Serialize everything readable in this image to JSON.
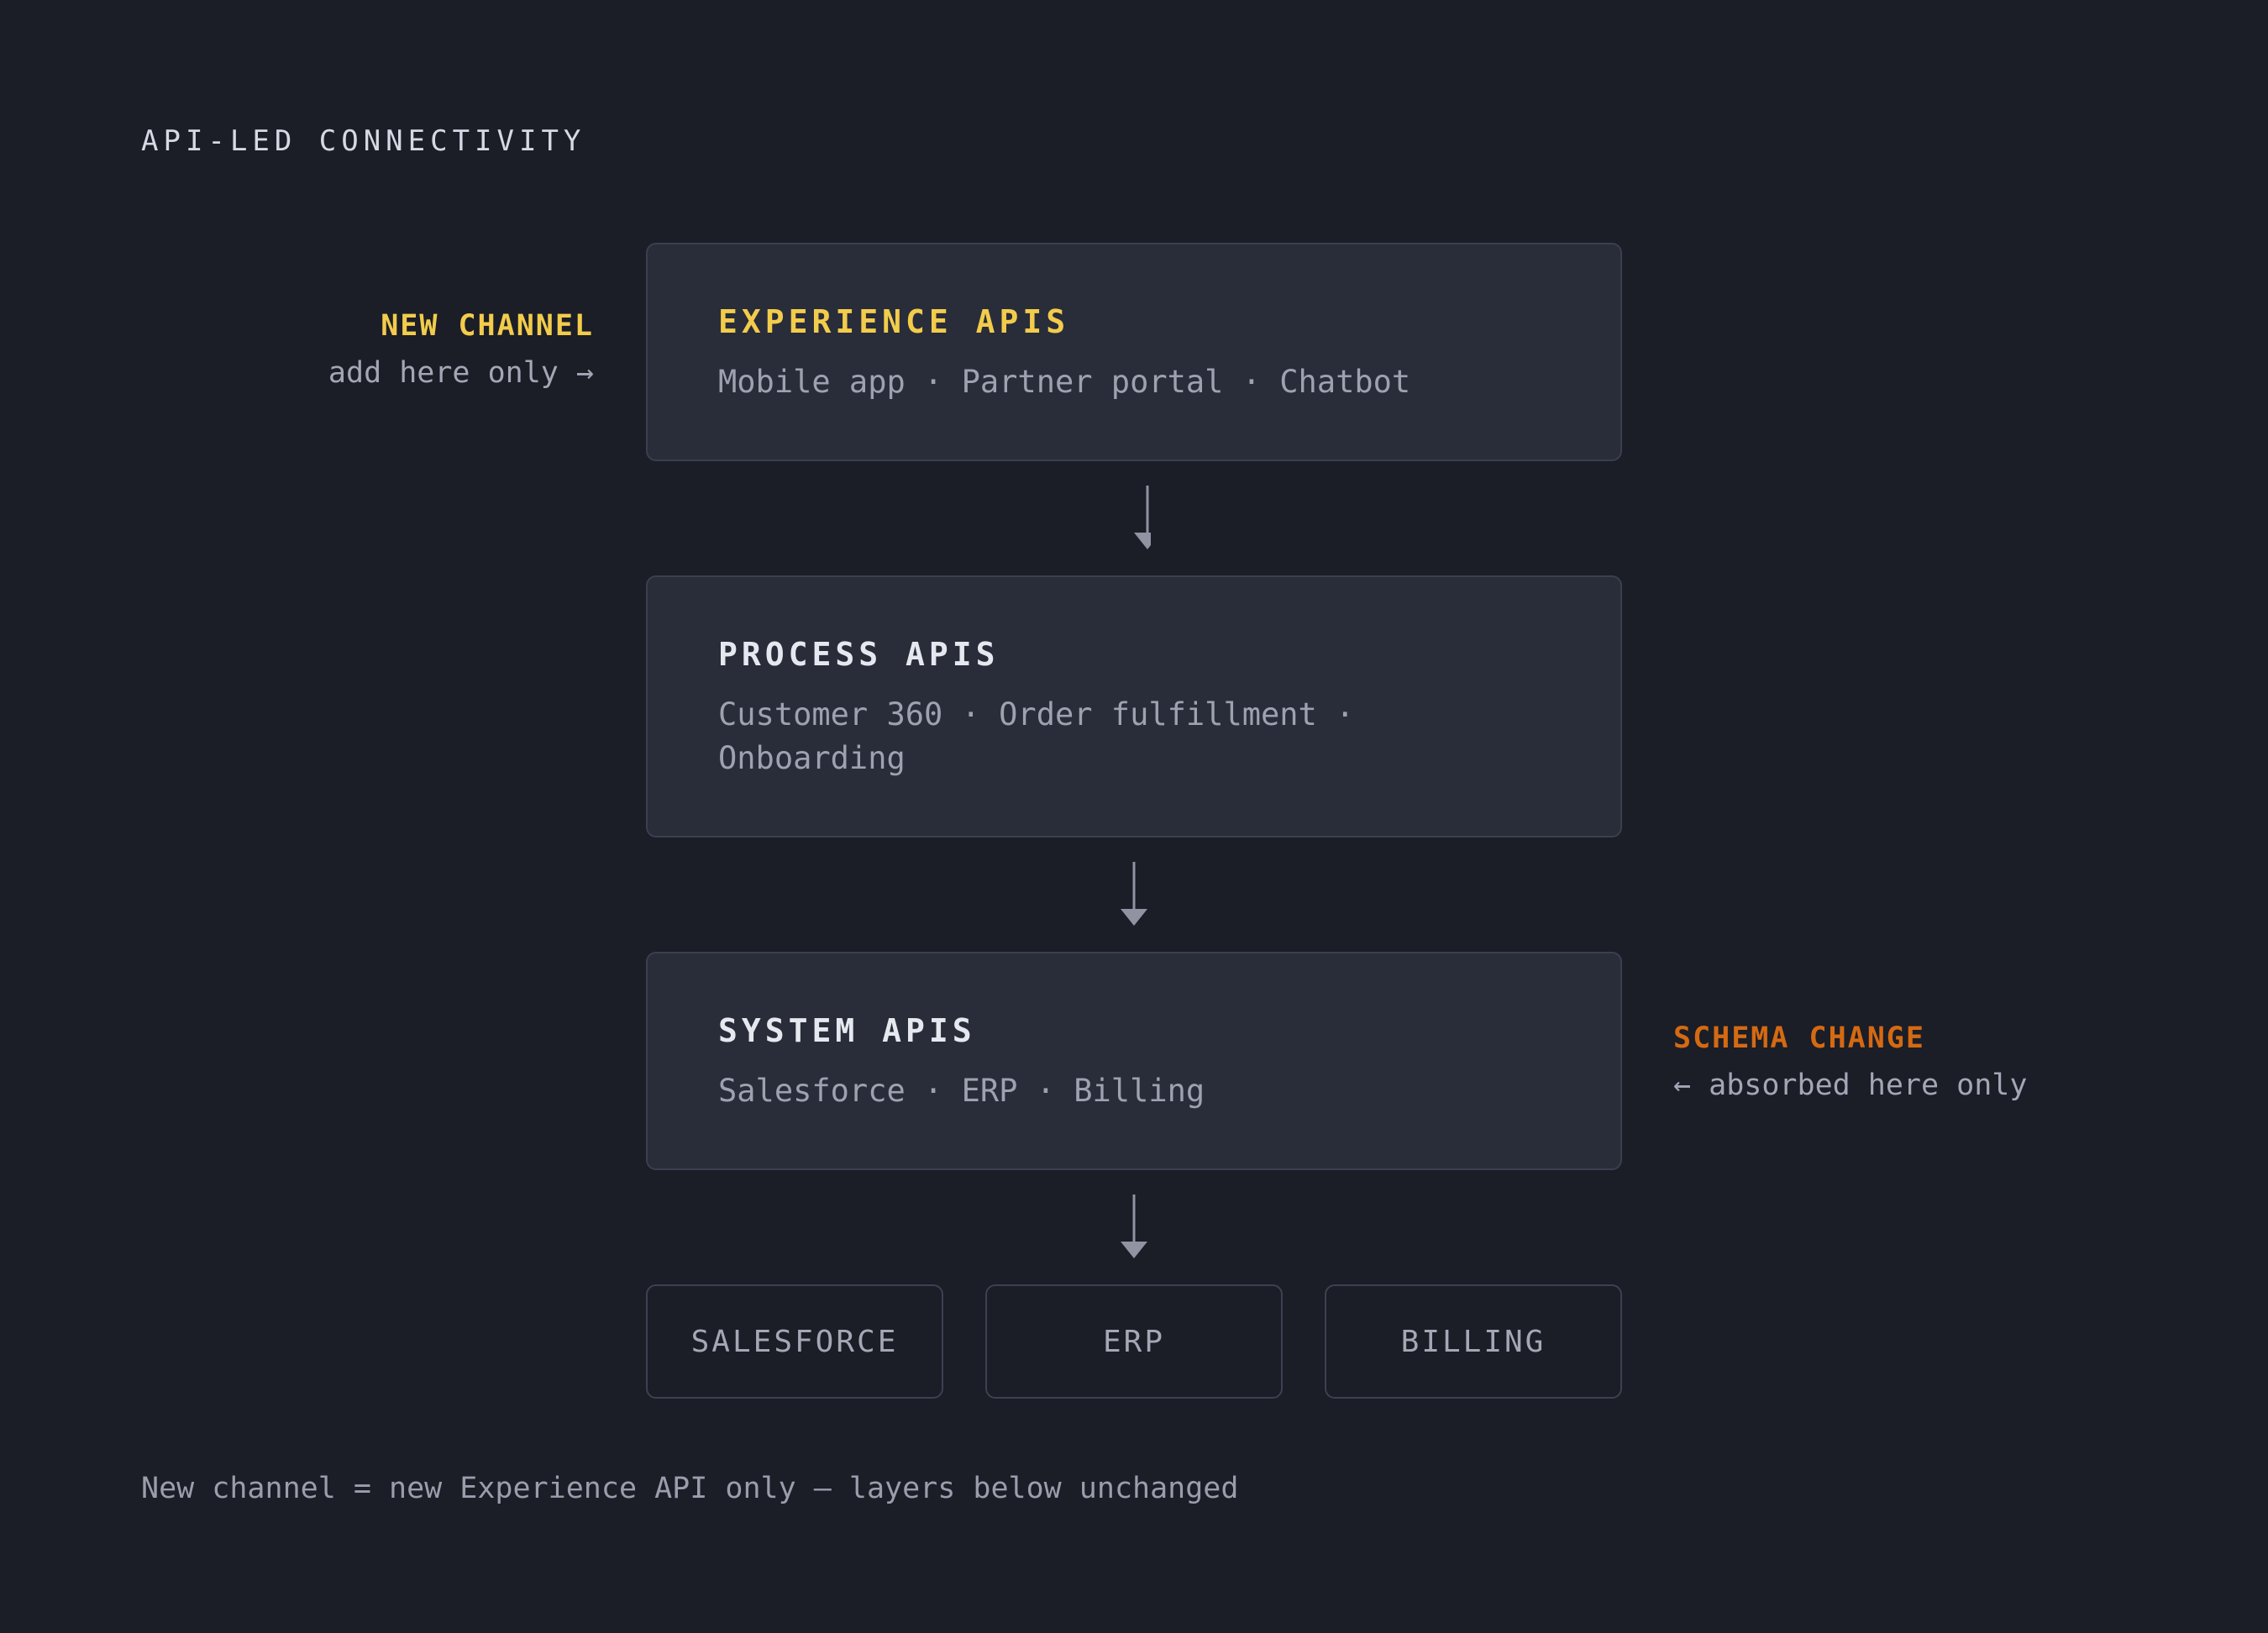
{
  "heading": "API-LED CONNECTIVITY",
  "colors": {
    "experience_accent": "#f2cc4b",
    "schema_accent": "#d46a12",
    "background": "#1b1d27",
    "card": "#292c39"
  },
  "layers": [
    {
      "title": "EXPERIENCE APIS",
      "items": "Mobile app · Partner portal · Chatbot"
    },
    {
      "title": "PROCESS APIS",
      "items": "Customer 360 · Order fulfillment · Onboarding"
    },
    {
      "title": "SYSTEM APIS",
      "items": "Salesforce · ERP · Billing"
    }
  ],
  "sources": [
    "SALESFORCE",
    "ERP",
    "BILLING"
  ],
  "annotations": {
    "new_channel": {
      "title": "NEW CHANNEL",
      "note": "add here only →"
    },
    "schema_change": {
      "title": "SCHEMA CHANGE",
      "note": "← absorbed here only"
    }
  },
  "footer": "New channel = new Experience API only — layers below unchanged"
}
